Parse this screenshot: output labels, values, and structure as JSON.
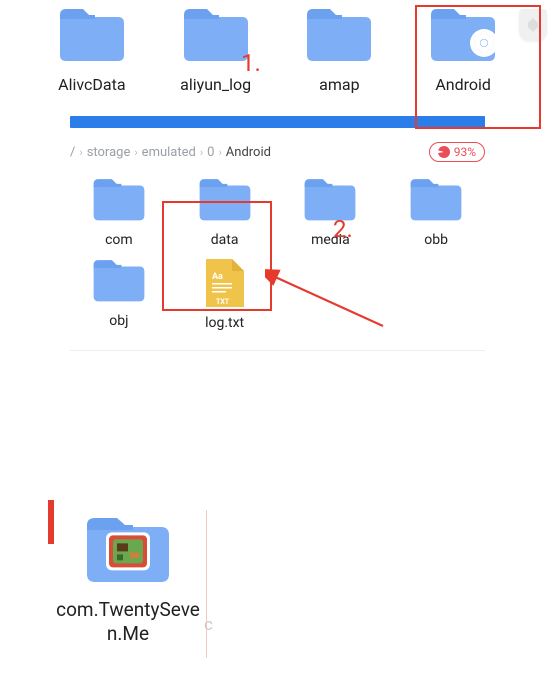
{
  "row1": [
    {
      "label": "AlivcData",
      "type": "folder"
    },
    {
      "label": "aliyun_log",
      "type": "folder"
    },
    {
      "label": "amap",
      "type": "folder"
    },
    {
      "label": "Android",
      "type": "folder",
      "overlay": "gear-icon"
    }
  ],
  "annotations": {
    "a1": "1.",
    "a2": "2."
  },
  "breadcrumb": {
    "root": "/",
    "segments": [
      "storage",
      "emulated",
      "0"
    ],
    "current": "Android"
  },
  "storage_used": "93%",
  "grid": [
    {
      "label": "com",
      "type": "folder"
    },
    {
      "label": "data",
      "type": "folder"
    },
    {
      "label": "media",
      "type": "folder"
    },
    {
      "label": "obb",
      "type": "folder"
    },
    {
      "label": "obj",
      "type": "folder"
    },
    {
      "label": "log.txt",
      "type": "txt"
    }
  ],
  "bottom": {
    "label": "com.TwentySeven.Me",
    "stray": "c"
  }
}
